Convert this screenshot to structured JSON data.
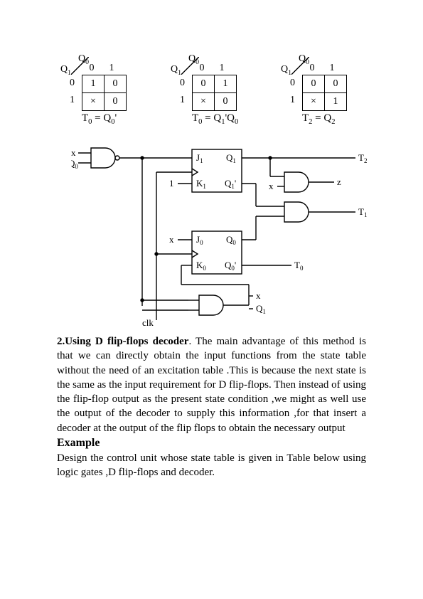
{
  "kmaps": [
    {
      "q0_label": "Q",
      "q0_sub": "0",
      "q1_label": "Q",
      "q1_sub": "1",
      "col0": "0",
      "col1": "1",
      "row0": "0",
      "row1": "1",
      "c00": "1",
      "c01": "0",
      "c10": "×",
      "c11": "0",
      "caption_lhs": "T",
      "caption_sub": "0",
      "caption_eq": " = Q",
      "caption_rhs_sub": "0",
      "caption_tail": "'"
    },
    {
      "q0_label": "Q",
      "q0_sub": "0",
      "q1_label": "Q",
      "q1_sub": "1",
      "col0": "0",
      "col1": "1",
      "row0": "0",
      "row1": "1",
      "c00": "0",
      "c01": "1",
      "c10": "×",
      "c11": "0",
      "caption_lhs": "T",
      "caption_sub": "0",
      "caption_eq": " = Q",
      "caption_rhs_sub": "1",
      "caption_tail": "'Q",
      "caption_tail_sub": "0"
    },
    {
      "q0_label": "Q",
      "q0_sub": "0",
      "q1_label": "Q",
      "q1_sub": "1",
      "col0": "0",
      "col1": "1",
      "row0": "0",
      "row1": "1",
      "c00": "0",
      "c01": "0",
      "c10": "×",
      "c11": "1",
      "caption_lhs": "T",
      "caption_sub": "2",
      "caption_eq": " = Q",
      "caption_rhs_sub": "2",
      "caption_tail": ""
    }
  ],
  "circuit": {
    "in_x": "x",
    "in_q0": "Q",
    "in_q0_sub": "0",
    "in_1": "1",
    "clk": "clk",
    "ff1_j": "J",
    "ff1_j_sub": "1",
    "ff1_k": "K",
    "ff1_k_sub": "1",
    "ff1_q": "Q",
    "ff1_q_sub": "1",
    "ff1_qn": "Q",
    "ff1_qn_sub": "1",
    "ff1_qn_prime": "'",
    "ff0_j": "J",
    "ff0_j_sub": "0",
    "ff0_k": "K",
    "ff0_k_sub": "0",
    "ff0_q": "Q",
    "ff0_q_sub": "0",
    "ff0_qn": "Q",
    "ff0_qn_sub": "0",
    "ff0_qn_prime": "'",
    "out_t2": "T",
    "out_t2_sub": "2",
    "out_t1": "T",
    "out_t1_sub": "1",
    "out_t0": "T",
    "out_t0_sub": "0",
    "out_z": "z",
    "and_in_x": "x",
    "and3_x": "x",
    "and3_q1": "Q",
    "and3_q1_sub": "1"
  },
  "text": {
    "para1_lead": "2.Using D flip-flops decoder",
    "para1": ". The main advantage of this method is that we can directly obtain the input functions from the state table without the need of an excitation table .This is because the next state is the same as the input requirement for D flip-flops. Then instead of using the flip-flop output as the present state condition ,we might as well use the output of the decoder to supply this information ,for that insert a decoder at the output  of the flip flops to obtain the necessary output",
    "example": "Example",
    "para2": "Design the control unit whose state table is given in Table below using logic gates ,D flip-flops and decoder."
  },
  "chart_data": {
    "type": "table",
    "description": "Three 2x2 Karnaugh maps with inputs Q1 (rows) and Q0 (columns)",
    "maps": [
      {
        "name": "T0 = Q0'",
        "rows_Q1": [
          0,
          1
        ],
        "cols_Q0": [
          0,
          1
        ],
        "cells": [
          [
            "1",
            "0"
          ],
          [
            "×",
            "0"
          ]
        ]
      },
      {
        "name": "T0 = Q1'Q0",
        "rows_Q1": [
          0,
          1
        ],
        "cols_Q0": [
          0,
          1
        ],
        "cells": [
          [
            "0",
            "1"
          ],
          [
            "×",
            "0"
          ]
        ]
      },
      {
        "name": "T2 = Q2",
        "rows_Q1": [
          0,
          1
        ],
        "cols_Q0": [
          0,
          1
        ],
        "cells": [
          [
            "0",
            "0"
          ],
          [
            "×",
            "1"
          ]
        ]
      }
    ]
  }
}
